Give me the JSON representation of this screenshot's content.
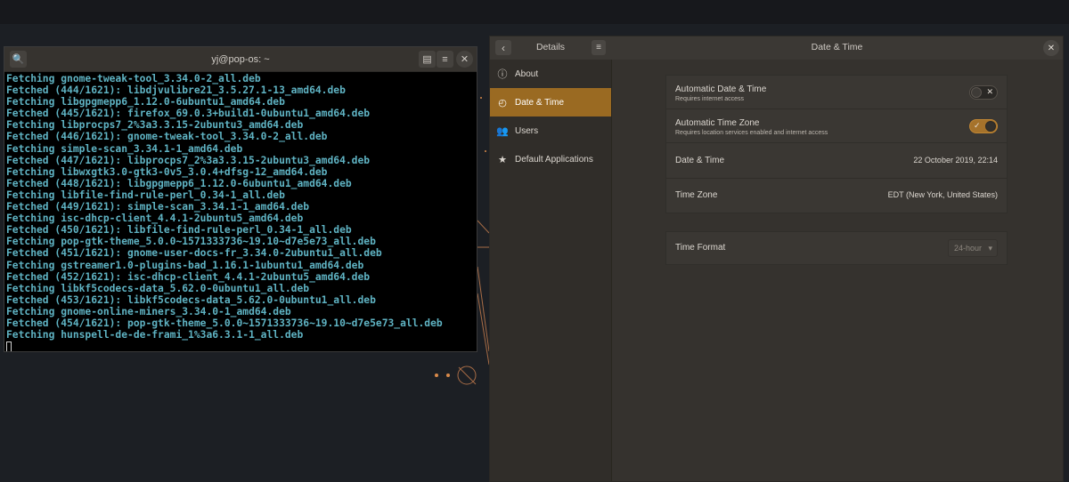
{
  "terminal": {
    "title": "yj@pop-os: ~",
    "lines": [
      [
        "Fetching",
        "gnome-tweak-tool_3.34.0-2_all.deb"
      ],
      [
        "Fetched (444/1621):",
        "libdjvulibre21_3.5.27.1-13_amd64.deb"
      ],
      [
        "Fetching",
        "libgpgmepp6_1.12.0-6ubuntu1_amd64.deb"
      ],
      [
        "Fetched (445/1621):",
        "firefox_69.0.3+build1-0ubuntu1_amd64.deb"
      ],
      [
        "Fetching",
        "libprocps7_2%3a3.3.15-2ubuntu3_amd64.deb"
      ],
      [
        "Fetched (446/1621):",
        "gnome-tweak-tool_3.34.0-2_all.deb"
      ],
      [
        "Fetching",
        "simple-scan_3.34.1-1_amd64.deb"
      ],
      [
        "Fetched (447/1621):",
        "libprocps7_2%3a3.3.15-2ubuntu3_amd64.deb"
      ],
      [
        "Fetching",
        "libwxgtk3.0-gtk3-0v5_3.0.4+dfsg-12_amd64.deb"
      ],
      [
        "Fetched (448/1621):",
        "libgpgmepp6_1.12.0-6ubuntu1_amd64.deb"
      ],
      [
        "Fetching",
        "libfile-find-rule-perl_0.34-1_all.deb"
      ],
      [
        "Fetched (449/1621):",
        "simple-scan_3.34.1-1_amd64.deb"
      ],
      [
        "Fetching",
        "isc-dhcp-client_4.4.1-2ubuntu5_amd64.deb"
      ],
      [
        "Fetched (450/1621):",
        "libfile-find-rule-perl_0.34-1_all.deb"
      ],
      [
        "Fetching",
        "pop-gtk-theme_5.0.0~1571333736~19.10~d7e5e73_all.deb"
      ],
      [
        "Fetched (451/1621):",
        "gnome-user-docs-fr_3.34.0-2ubuntu1_all.deb"
      ],
      [
        "Fetching",
        "gstreamer1.0-plugins-bad_1.16.1-1ubuntu1_amd64.deb"
      ],
      [
        "Fetched (452/1621):",
        "isc-dhcp-client_4.4.1-2ubuntu5_amd64.deb"
      ],
      [
        "Fetching",
        "libkf5codecs-data_5.62.0-0ubuntu1_all.deb"
      ],
      [
        "Fetched (453/1621):",
        "libkf5codecs-data_5.62.0-0ubuntu1_all.deb"
      ],
      [
        "Fetching",
        "gnome-online-miners_3.34.0-1_amd64.deb"
      ],
      [
        "Fetched (454/1621):",
        "pop-gtk-theme_5.0.0~1571333736~19.10~d7e5e73_all.deb"
      ],
      [
        "Fetching",
        "hunspell-de-de-frami_1%3a6.3.1-1_all.deb"
      ]
    ]
  },
  "settings": {
    "sidebar_title": "Details",
    "panel_title": "Date & Time",
    "sidebar_items": [
      {
        "label": "About",
        "icon": "info-icon"
      },
      {
        "label": "Date & Time",
        "icon": "clock-icon",
        "active": true
      },
      {
        "label": "Users",
        "icon": "users-icon"
      },
      {
        "label": "Default Applications",
        "icon": "star-icon"
      }
    ],
    "auto_date_time": {
      "title": "Automatic Date & Time",
      "subtitle": "Requires internet access",
      "enabled": false
    },
    "auto_time_zone": {
      "title": "Automatic Time Zone",
      "subtitle": "Requires location services enabled and internet access",
      "enabled": true
    },
    "date_time": {
      "title": "Date & Time",
      "value": "22 October 2019, 22:14"
    },
    "time_zone": {
      "title": "Time Zone",
      "value": "EDT (New York, United States)"
    },
    "time_format": {
      "title": "Time Format",
      "value": "24-hour"
    }
  },
  "colors": {
    "accent": "#9a6a22",
    "terminal_text": "#5fb3c3"
  }
}
